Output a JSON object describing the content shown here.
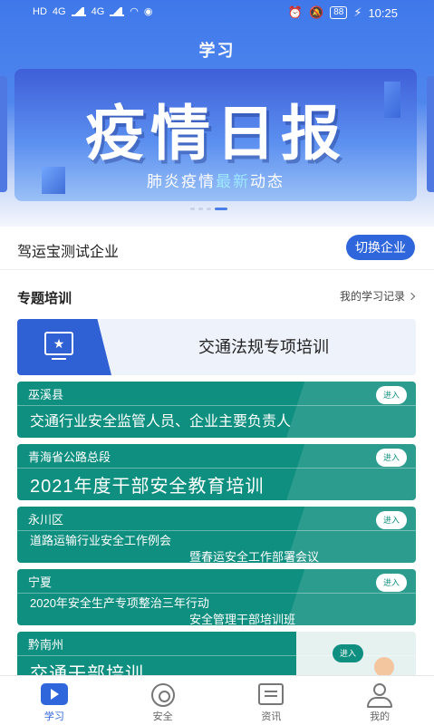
{
  "status_bar": {
    "carrier_left": [
      "HD",
      "HD"
    ],
    "signal_labels": [
      "4G",
      "4G"
    ],
    "battery": "88",
    "time": "10:25"
  },
  "header": {
    "title": "学习"
  },
  "banner": {
    "title": "疫情日报",
    "subtitle_pre": "肺炎疫情",
    "subtitle_highlight": "最新",
    "subtitle_post": "动态",
    "pages": 4,
    "active_page": 3
  },
  "company": {
    "name": "驾运宝测试企业",
    "switch_label": "切换企业"
  },
  "section": {
    "title": "专题培训",
    "record_link": "我的学习记录"
  },
  "topic": {
    "label": "交通法规专项培训"
  },
  "trainings": [
    {
      "region": "巫溪县",
      "name": "交通行业安全监管人员、企业主要负责人",
      "enter": "进入"
    },
    {
      "region": "青海省公路总段",
      "name": "2021年度干部安全教育培训",
      "enter": "进入"
    },
    {
      "region": "永川区",
      "name": "道路运输行业安全工作例会",
      "name2": "暨春运安全工作部署会议",
      "enter": "进入"
    },
    {
      "region": "宁夏",
      "name": "2020年安全生产专项整治三年行动",
      "name2": "安全管理干部培训班",
      "enter": "进入"
    },
    {
      "region": "黔南州",
      "name": "交通干部培训",
      "enter": "进入"
    }
  ],
  "tabbar": {
    "tabs": [
      {
        "label": "学习",
        "icon": "play-icon"
      },
      {
        "label": "安全",
        "icon": "safety-icon"
      },
      {
        "label": "资讯",
        "icon": "news-icon"
      },
      {
        "label": "我的",
        "icon": "profile-icon"
      }
    ]
  },
  "colors": {
    "primary": "#2f66dc",
    "card_teal": "#0f8f80"
  }
}
